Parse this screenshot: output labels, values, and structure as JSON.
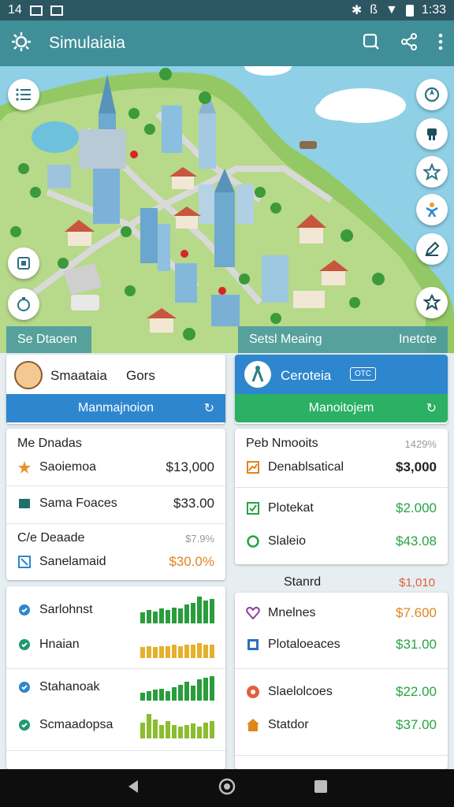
{
  "status_bar": {
    "time_left": "14",
    "time_right": "1:33"
  },
  "app_bar": {
    "title": "Simulaiaia"
  },
  "map_strip": {
    "left": "Se Dtaoen",
    "center": "Setsl Meaing",
    "right": "Inetcte"
  },
  "card_left": {
    "name": "Smaataia",
    "extra": "Gors",
    "button": "Manmajnoion"
  },
  "card_right": {
    "name": "Ceroteia",
    "badge": "OTC",
    "button": "Manoitojem"
  },
  "list_left": {
    "header1": "Me Dnadas",
    "rows1": [
      {
        "label": "Saoiemoa",
        "value": "$13,000"
      },
      {
        "label": "Sama Foaces",
        "value": "$33.00"
      }
    ],
    "header2": "C/e Deaade",
    "header2_value": "$7.9%",
    "rows2": [
      {
        "label": "Sanelamaid",
        "value": "$30.0%"
      }
    ]
  },
  "list_right": {
    "header": "Peb Nmooits",
    "header_value": "1429%",
    "rows": [
      {
        "label": "Denablsatical",
        "value": "$3,000"
      },
      {
        "label": "Plotekat",
        "value": "$2.000"
      },
      {
        "label": "Slaleio",
        "value": "$43.08"
      }
    ]
  },
  "stand": {
    "label": "Stanrd",
    "value": "$1,010"
  },
  "stats_left": {
    "rows": [
      {
        "label": "Sarlohnst",
        "bars": [
          0.4,
          0.5,
          0.45,
          0.55,
          0.5,
          0.6,
          0.55,
          0.7,
          0.75,
          1.0,
          0.85,
          0.9
        ],
        "color": "#2a9d3c"
      },
      {
        "label": "Hnaian",
        "bars": [
          0.4,
          0.45,
          0.4,
          0.45,
          0.45,
          0.5,
          0.45,
          0.5,
          0.5,
          0.55,
          0.5,
          0.5
        ],
        "color": "#e4b12c"
      },
      {
        "label": "Stahanoak",
        "bars": [
          0.3,
          0.35,
          0.4,
          0.45,
          0.35,
          0.5,
          0.6,
          0.7,
          0.55,
          0.8,
          0.85,
          0.9
        ],
        "color": "#2a9d3c"
      },
      {
        "label": "Scmaadopsa",
        "bars": [
          0.6,
          0.9,
          0.7,
          0.5,
          0.65,
          0.5,
          0.45,
          0.5,
          0.55,
          0.45,
          0.6,
          0.65
        ],
        "color": "#8bbd2e"
      }
    ]
  },
  "stats_right": {
    "rows": [
      {
        "label": "Mnelnes",
        "value": "$7.600"
      },
      {
        "label": "Plotaloeaces",
        "value": "$31.00"
      },
      {
        "label": "Slaelolcoes",
        "value": "$22.00"
      },
      {
        "label": "Statdor",
        "value": "$37.00"
      }
    ]
  },
  "colors": {
    "teal": "#3f8e98",
    "blue_btn": "#2e86cf",
    "green_btn": "#2bb064",
    "green_val": "#27a344",
    "orange_val": "#e0851d"
  }
}
